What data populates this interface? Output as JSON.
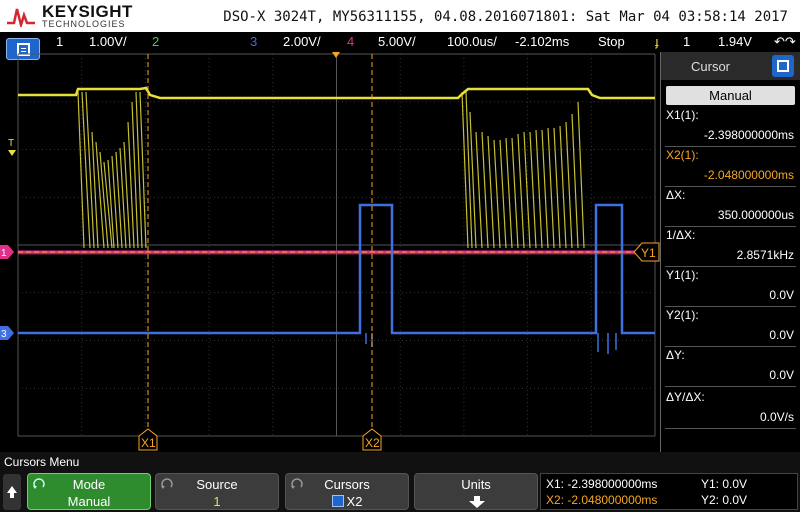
{
  "header": {
    "brand": "KEYSIGHT",
    "brand_sub": "TECHNOLOGIES",
    "title": "DSO-X 3024T, MY56311155, 04.08.2016071801: Sat Mar 04 03:58:14 2017"
  },
  "status": {
    "ch1_num": "1",
    "ch1_scale": "1.00V/",
    "ch2_num": "2",
    "ch3_num": "3",
    "ch3_scale": "2.00V/",
    "ch4_num": "4",
    "ch4_scale": "5.00V/",
    "timebase": "100.0us/",
    "delay": "-2.102ms",
    "run_state": "Stop",
    "trigger_symbol": "ɟ",
    "trigger_channel": "1",
    "trigger_level": "1.94V",
    "zoom_symbol": "↶↷"
  },
  "colors": {
    "ch1": "#e8e03a",
    "ch2": "#3bd44a",
    "ch3": "#3f6fe0",
    "ch4": "#e0308a",
    "cursor": "#f5a623",
    "accent_blue": "#1f66c8",
    "mode_green": "#2e8b2e"
  },
  "plot": {
    "trigger_marker": "T",
    "ch1_marker": "1",
    "ch3_marker": "3",
    "x1_label": "X1",
    "x2_label": "X2",
    "y1_label": "Y1"
  },
  "cursor_panel": {
    "title": "Cursor",
    "icon": "menu-icon",
    "mode": "Manual",
    "x1_label": "X1(1):",
    "x1_value": "-2.398000000ms",
    "x2_label": "X2(1):",
    "x2_value": "-2.048000000ms",
    "dx_label": "ΔX:",
    "dx_value": "350.000000us",
    "inv_dx_label": "1/ΔX:",
    "inv_dx_value": "2.8571kHz",
    "y1_label": "Y1(1):",
    "y1_value": "0.0V",
    "y2_label": "Y2(1):",
    "y2_value": "0.0V",
    "dy_label": "ΔY:",
    "dy_value": "0.0V",
    "dydx_label": "ΔY/ΔX:",
    "dydx_value": "0.0V/s"
  },
  "softkeys": {
    "menu_title": "Cursors Menu",
    "mode_label": "Mode",
    "mode_value": "Manual",
    "source_label": "Source",
    "source_value": "1",
    "cursors_label": "Cursors",
    "cursors_value": "X2",
    "units_label": "Units"
  },
  "readout": {
    "x1": "X1: -2.398000000ms",
    "x2": "X2: -2.048000000ms",
    "y1": "Y1: 0.0V",
    "y2": "Y2: 0.0V"
  }
}
